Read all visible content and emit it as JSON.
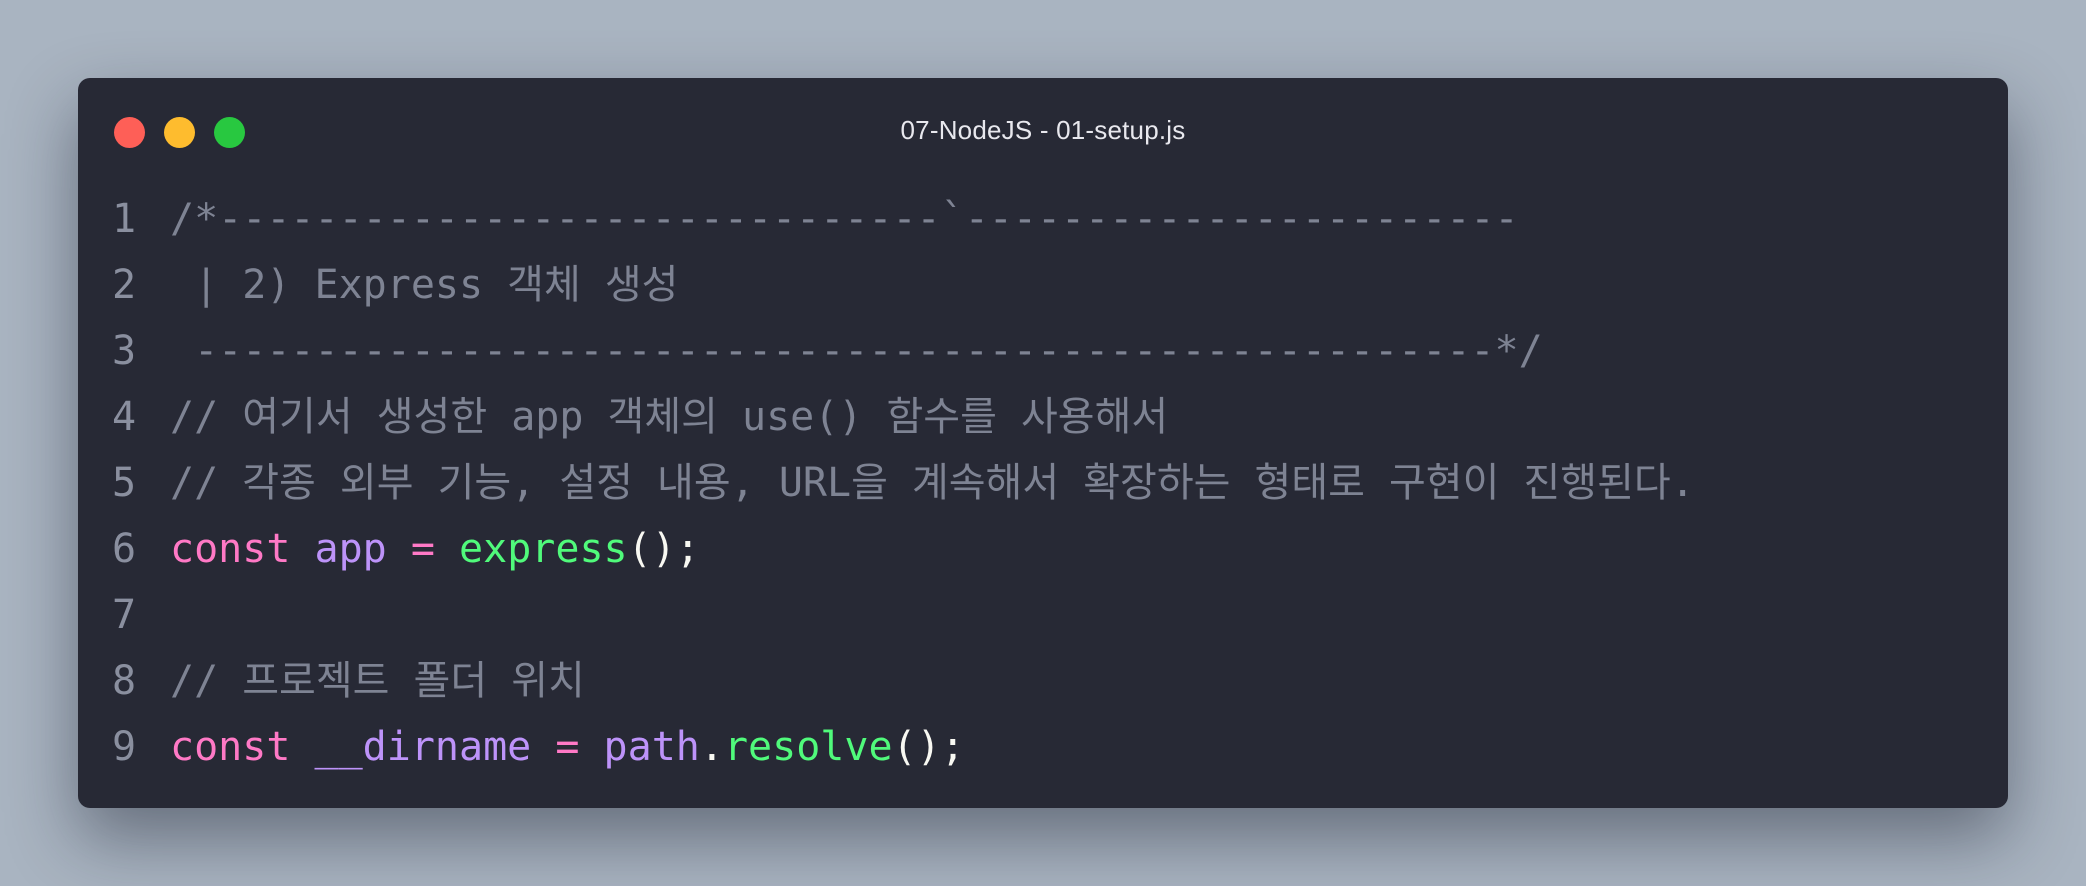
{
  "window": {
    "title": "07-NodeJS - 01-setup.js",
    "background": "#272935",
    "page_background": "#a9b4c1",
    "buttons": [
      {
        "name": "close",
        "color": "#fe5f57"
      },
      {
        "name": "minimize",
        "color": "#febc2e"
      },
      {
        "name": "zoom",
        "color": "#28c840"
      }
    ]
  },
  "editor": {
    "language": "javascript",
    "lines": [
      {
        "number": "1",
        "tokens": [
          {
            "type": "comment",
            "text": "/*------------------------------`-----------------------"
          }
        ]
      },
      {
        "number": "2",
        "tokens": [
          {
            "type": "comment",
            "text": " | 2) Express 객체 생성"
          }
        ]
      },
      {
        "number": "3",
        "tokens": [
          {
            "type": "comment",
            "text": " ------------------------------------------------------*/"
          }
        ]
      },
      {
        "number": "4",
        "tokens": [
          {
            "type": "comment",
            "text": "// 여기서 생성한 app 객체의 use() 함수를 사용해서"
          }
        ]
      },
      {
        "number": "5",
        "tokens": [
          {
            "type": "comment",
            "text": "// 각종 외부 기능, 설정 내용, URL을 계속해서 확장하는 형태로 구현이 진행된다."
          }
        ]
      },
      {
        "number": "6",
        "tokens": [
          {
            "type": "keyword",
            "text": "const"
          },
          {
            "type": "punc",
            "text": " "
          },
          {
            "type": "var",
            "text": "app"
          },
          {
            "type": "punc",
            "text": " "
          },
          {
            "type": "op",
            "text": "="
          },
          {
            "type": "punc",
            "text": " "
          },
          {
            "type": "func",
            "text": "express"
          },
          {
            "type": "punc",
            "text": "();"
          }
        ]
      },
      {
        "number": "7",
        "tokens": []
      },
      {
        "number": "8",
        "tokens": [
          {
            "type": "comment",
            "text": "// 프로젝트 폴더 위치"
          }
        ]
      },
      {
        "number": "9",
        "tokens": [
          {
            "type": "keyword",
            "text": "const"
          },
          {
            "type": "punc",
            "text": " "
          },
          {
            "type": "var",
            "text": "__dirname"
          },
          {
            "type": "punc",
            "text": " "
          },
          {
            "type": "op",
            "text": "="
          },
          {
            "type": "punc",
            "text": " "
          },
          {
            "type": "var",
            "text": "path"
          },
          {
            "type": "punc",
            "text": "."
          },
          {
            "type": "func",
            "text": "resolve"
          },
          {
            "type": "punc",
            "text": "();"
          }
        ]
      }
    ]
  }
}
